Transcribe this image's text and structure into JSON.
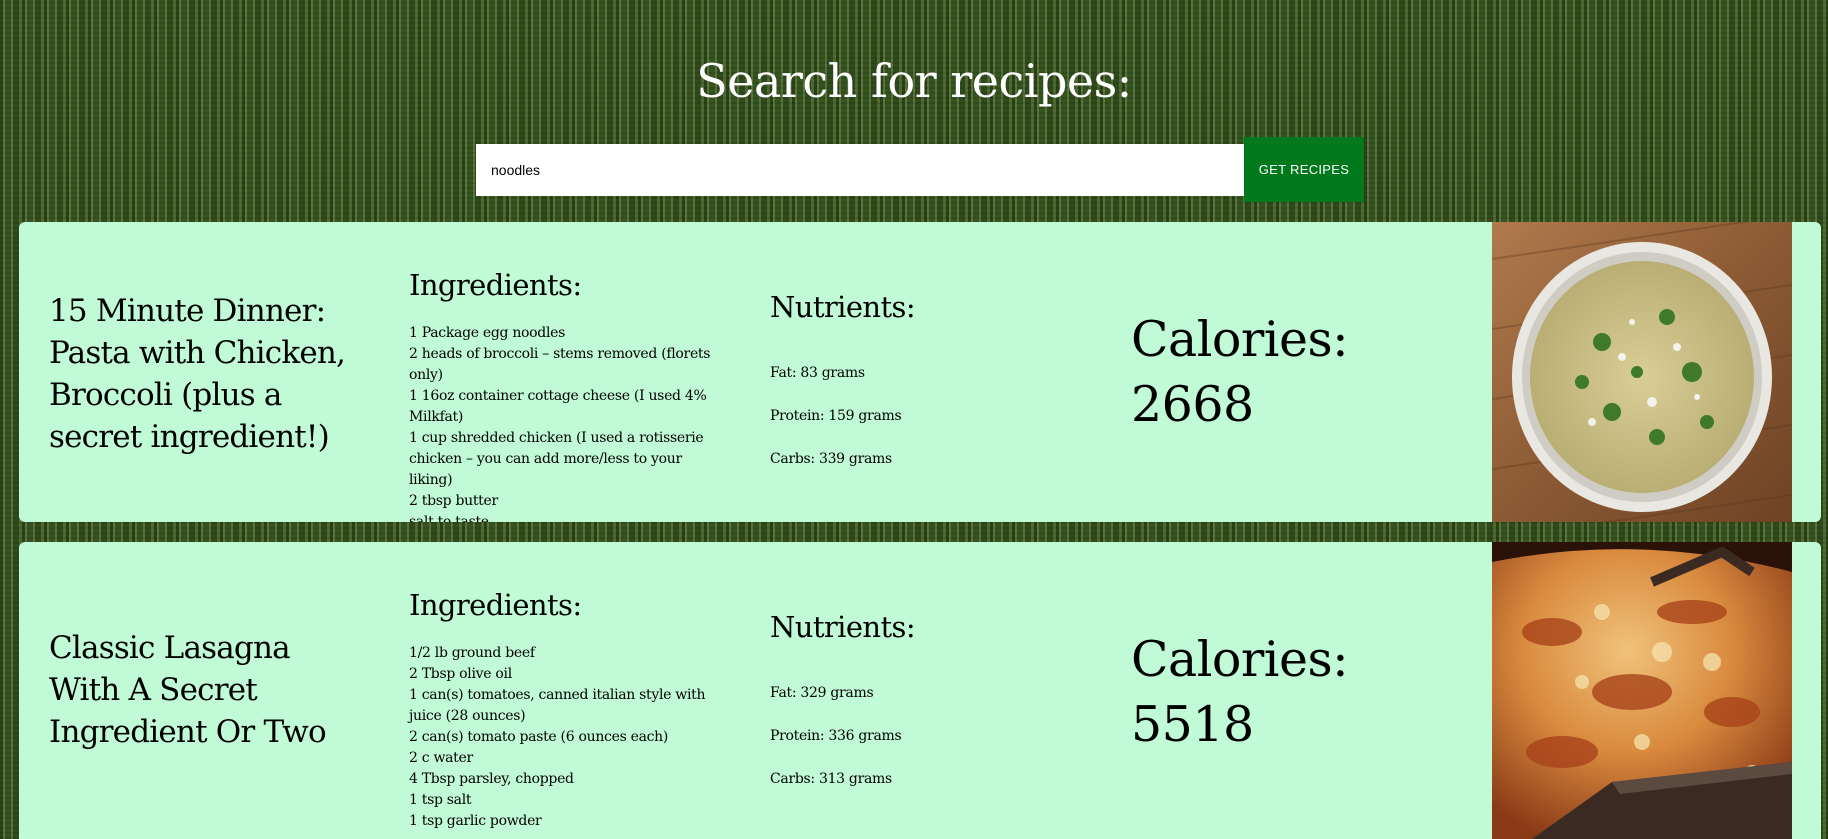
{
  "header": {
    "title": "Search for recipes:"
  },
  "search": {
    "value": "noodles",
    "button_label": "GET RECIPES"
  },
  "colors": {
    "card_background": "#c1fad6",
    "button_background": "#00791c",
    "page_background": "#3e5a26"
  },
  "recipes": [
    {
      "title": "15 Minute Dinner: Pasta with Chicken, Broccoli (plus a secret ingredient!)",
      "ingredients_heading": "Ingredients:",
      "ingredients": [
        "1 Package egg noodles",
        "2 heads of broccoli – stems removed (florets only)",
        "1 16oz container cottage cheese (I used 4% Milkfat)",
        "1 cup shredded chicken (I used a rotisserie chicken – you can add more/less to your liking)",
        "2 tbsp butter",
        "salt to taste"
      ],
      "nutrients_heading": "Nutrients:",
      "fat": "Fat: 83 grams",
      "protein": "Protein: 159 grams",
      "carbs": "Carbs: 339 grams",
      "calories_label": "Calories:",
      "calories_value": "2668"
    },
    {
      "title": "Classic Lasagna With A Secret Ingredient Or Two",
      "ingredients_heading": "Ingredients:",
      "ingredients": [
        "1/2 lb ground beef",
        "2 Tbsp olive oil",
        "1 can(s) tomatoes, canned italian style with juice (28 ounces)",
        "2 can(s) tomato paste (6 ounces each)",
        "2 c water",
        "4 Tbsp parsley, chopped",
        "1 tsp salt",
        "1 tsp garlic powder"
      ],
      "nutrients_heading": "Nutrients:",
      "fat": "Fat: 329 grams",
      "protein": "Protein: 336 grams",
      "carbs": "Carbs: 313 grams",
      "calories_label": "Calories:",
      "calories_value": "5518"
    }
  ]
}
